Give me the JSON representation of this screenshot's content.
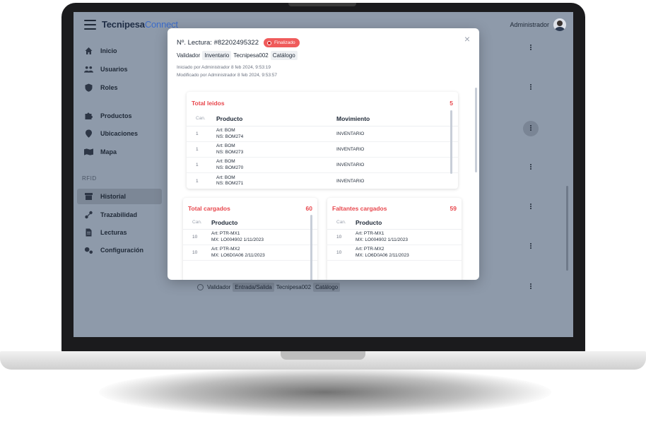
{
  "app": {
    "brand_part1": "Tecnipesa",
    "brand_part2": "Connect",
    "user_name": "Administrador"
  },
  "sidebar": {
    "items": [
      {
        "label": "Inicio",
        "icon": "home-icon"
      },
      {
        "label": "Usuarios",
        "icon": "users-icon"
      },
      {
        "label": "Roles",
        "icon": "shield-icon"
      },
      {
        "label": "Productos",
        "icon": "puzzle-icon"
      },
      {
        "label": "Ubicaciones",
        "icon": "location-pin-icon"
      },
      {
        "label": "Mapa",
        "icon": "map-icon"
      },
      {
        "label": "Historial",
        "icon": "archive-icon",
        "active": true
      },
      {
        "label": "Trazabilidad",
        "icon": "traceability-icon"
      },
      {
        "label": "Lecturas",
        "icon": "document-icon"
      },
      {
        "label": "Configuración",
        "icon": "gears-icon"
      }
    ],
    "section_rfid": "RFID"
  },
  "background_row": {
    "label": "Validador",
    "type_chip": "Entrada/Salida",
    "location": "Tecnipesa002",
    "catalog_chip": "Catálogo"
  },
  "modal": {
    "title": "Nº. Lectura: #82202495322",
    "status": "Finalizado",
    "tags": {
      "label": "Validador",
      "type": "Inventario",
      "location": "Tecnipesa002",
      "catalog": "Catálogo"
    },
    "started": "Iniciado por Administrador 8 feb 2024, 9:53:19",
    "modified": "Modificado por Administrador 8 feb 2024, 9:53:57",
    "close_label": "×",
    "total_leidos": {
      "title": "Total leidos",
      "count": "5",
      "col_qty": "Can.",
      "col_product": "Producto",
      "col_movement": "Movimiento",
      "rows": [
        {
          "qty": "1",
          "art": "Art: BOM",
          "ns": "NS: BOM274",
          "movement": "INVENTARIO"
        },
        {
          "qty": "1",
          "art": "Art: BOM",
          "ns": "NS: BOM273",
          "movement": "INVENTARIO"
        },
        {
          "qty": "1",
          "art": "Art: BOM",
          "ns": "NS: BOM270",
          "movement": "INVENTARIO"
        },
        {
          "qty": "1",
          "art": "Art: BOM",
          "ns": "NS: BOM271",
          "movement": "INVENTARIO"
        }
      ]
    },
    "total_cargados": {
      "title": "Total cargados",
      "count": "60",
      "col_qty": "Can.",
      "col_product": "Producto",
      "rows": [
        {
          "qty": "10",
          "art": "Art: PTR-MX1",
          "mx": "MX: LO004902 1/11/2023"
        },
        {
          "qty": "10",
          "art": "Art: PTR-MX2",
          "mx": "MX: LO6D0A06 2/11/2023"
        }
      ]
    },
    "faltantes_cargados": {
      "title": "Faltantes cargados",
      "count": "59",
      "col_qty": "Can.",
      "col_product": "Producto",
      "rows": [
        {
          "qty": "10",
          "art": "Art: PTR-MX1",
          "mx": "MX: LO004902 1/11/2023"
        },
        {
          "qty": "10",
          "art": "Art: PTR-MX2",
          "mx": "MX: LO6D0A06 2/11/2023"
        }
      ]
    }
  },
  "colors": {
    "accent_red": "#e8474d",
    "overlay": "#8e9aaa",
    "brand_blue": "#3b6bc9"
  }
}
